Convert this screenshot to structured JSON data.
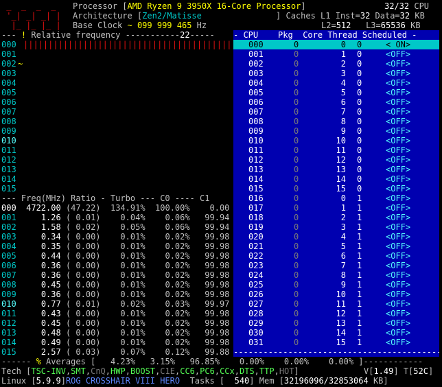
{
  "header": {
    "processor_label": "Processor [",
    "processor_name": "AMD Ryzen 9 3950X 16-Core Processor",
    "processor_close": "]",
    "cpu_count": "32/32",
    "cpu_label": "CPU",
    "arch_label": "Architecture [",
    "arch_value": "Zen2/Matisse",
    "arch_close": "]",
    "caches_label": "Caches L1 Inst=",
    "l1_inst": "32",
    "l1_data_label": "Data=",
    "l1_data": "32",
    "kb1": "KB",
    "base_clock_label": "Base Clock",
    "base_clock_tilde": "~",
    "base_clock_value": "099 999 465",
    "hz": "Hz",
    "l2_label": "L2=",
    "l2_value": "512",
    "l3_label": "L3=",
    "l3_value": "65536",
    "kb2": "KB"
  },
  "freq_header": {
    "prefix": "--- ",
    "excl": "!",
    "label": " Relative frequency -----------",
    "value": "22",
    "suffix": "-----"
  },
  "rows_top": [
    "000",
    "001",
    "002",
    "003",
    "004",
    "005",
    "006",
    "007",
    "008",
    "009",
    "010",
    "011",
    "012",
    "013",
    "014",
    "015"
  ],
  "row002_marker": "~",
  "stats_header": "--- Freq(MHz) Ratio - Turbo --- C0 ---- C1",
  "stats": [
    {
      "id": "000",
      "freq": "4722.00",
      "ratio": "(47.22)",
      "turbo": "134.91%",
      "c0": "100.00%",
      "c1": "0.00"
    },
    {
      "id": "001",
      "freq": "1.26",
      "ratio": "( 0.01)",
      "turbo": "0.04%",
      "c0": "0.06%",
      "c1": "99.94"
    },
    {
      "id": "002",
      "freq": "1.58",
      "ratio": "( 0.02)",
      "turbo": "0.05%",
      "c0": "0.06%",
      "c1": "99.94"
    },
    {
      "id": "003",
      "freq": "0.34",
      "ratio": "( 0.00)",
      "turbo": "0.01%",
      "c0": "0.02%",
      "c1": "99.98"
    },
    {
      "id": "004",
      "freq": "0.35",
      "ratio": "( 0.00)",
      "turbo": "0.01%",
      "c0": "0.02%",
      "c1": "99.98"
    },
    {
      "id": "005",
      "freq": "0.44",
      "ratio": "( 0.00)",
      "turbo": "0.01%",
      "c0": "0.02%",
      "c1": "99.98"
    },
    {
      "id": "006",
      "freq": "0.36",
      "ratio": "( 0.00)",
      "turbo": "0.01%",
      "c0": "0.02%",
      "c1": "99.98"
    },
    {
      "id": "007",
      "freq": "0.36",
      "ratio": "( 0.00)",
      "turbo": "0.01%",
      "c0": "0.02%",
      "c1": "99.98"
    },
    {
      "id": "008",
      "freq": "0.45",
      "ratio": "( 0.00)",
      "turbo": "0.01%",
      "c0": "0.02%",
      "c1": "99.98"
    },
    {
      "id": "009",
      "freq": "0.36",
      "ratio": "( 0.00)",
      "turbo": "0.01%",
      "c0": "0.02%",
      "c1": "99.98"
    },
    {
      "id": "010",
      "freq": "0.77",
      "ratio": "( 0.01)",
      "turbo": "0.02%",
      "c0": "0.03%",
      "c1": "99.97"
    },
    {
      "id": "011",
      "freq": "0.43",
      "ratio": "( 0.00)",
      "turbo": "0.01%",
      "c0": "0.02%",
      "c1": "99.98"
    },
    {
      "id": "012",
      "freq": "0.45",
      "ratio": "( 0.00)",
      "turbo": "0.01%",
      "c0": "0.02%",
      "c1": "99.98"
    },
    {
      "id": "013",
      "freq": "0.48",
      "ratio": "( 0.00)",
      "turbo": "0.01%",
      "c0": "0.02%",
      "c1": "99.98"
    },
    {
      "id": "014",
      "freq": "0.49",
      "ratio": "( 0.00)",
      "turbo": "0.01%",
      "c0": "0.02%",
      "c1": "99.98"
    },
    {
      "id": "015",
      "freq": "2.57",
      "ratio": "( 0.03)",
      "turbo": "0.07%",
      "c0": "0.12%",
      "c1": "99.88"
    }
  ],
  "averages": {
    "prefix": "------ ",
    "pct": "%",
    "label": " Averages [",
    "v1": "4.23%",
    "v2": "3.15%",
    "v3": "96.85%",
    "v4": "0.00%",
    "v5": "0.00%",
    "v6": "0.00%",
    "close": "]",
    "suffix": "------------"
  },
  "tech": {
    "label": "Tech [",
    "items": [
      "TSC-INV",
      "SMT",
      "CnQ",
      "HWP",
      "BOOST",
      "C1E",
      "CC6",
      "PC6",
      "CCx",
      "DTS",
      "TTP",
      "HOT"
    ],
    "close": "]",
    "v_label": "V[",
    "v_value": "1.49",
    "v_close": "]",
    "t_label": "T[",
    "t_value": "52C",
    "t_close": "]"
  },
  "status": {
    "linux_label": "Linux [",
    "kernel": "5.9.9",
    "kernel_close": "]",
    "host": "ROG CROSSHAIR VIII HERO",
    "tasks_label": "Tasks [",
    "tasks_value": "540",
    "tasks_close": "]",
    "mem_label": "Mem [",
    "mem_value": "32196096/32853064",
    "mem_unit": "KB",
    "mem_close": "]"
  },
  "panel": {
    "headers": {
      "cpu": "CPU",
      "pkg": "Pkg",
      "core": "Core",
      "thread": "Thread",
      "scheduled": "Scheduled"
    },
    "rows": [
      {
        "cpu": "000",
        "pkg": "0",
        "core": "0",
        "thread": "0",
        "sched": "< ON>"
      },
      {
        "cpu": "001",
        "pkg": "0",
        "core": "1",
        "thread": "0",
        "sched": "<OFF>"
      },
      {
        "cpu": "002",
        "pkg": "0",
        "core": "2",
        "thread": "0",
        "sched": "<OFF>"
      },
      {
        "cpu": "003",
        "pkg": "0",
        "core": "3",
        "thread": "0",
        "sched": "<OFF>"
      },
      {
        "cpu": "004",
        "pkg": "0",
        "core": "4",
        "thread": "0",
        "sched": "<OFF>"
      },
      {
        "cpu": "005",
        "pkg": "0",
        "core": "5",
        "thread": "0",
        "sched": "<OFF>"
      },
      {
        "cpu": "006",
        "pkg": "0",
        "core": "6",
        "thread": "0",
        "sched": "<OFF>"
      },
      {
        "cpu": "007",
        "pkg": "0",
        "core": "7",
        "thread": "0",
        "sched": "<OFF>"
      },
      {
        "cpu": "008",
        "pkg": "0",
        "core": "8",
        "thread": "0",
        "sched": "<OFF>"
      },
      {
        "cpu": "009",
        "pkg": "0",
        "core": "9",
        "thread": "0",
        "sched": "<OFF>"
      },
      {
        "cpu": "010",
        "pkg": "0",
        "core": "10",
        "thread": "0",
        "sched": "<OFF>"
      },
      {
        "cpu": "011",
        "pkg": "0",
        "core": "11",
        "thread": "0",
        "sched": "<OFF>"
      },
      {
        "cpu": "012",
        "pkg": "0",
        "core": "12",
        "thread": "0",
        "sched": "<OFF>"
      },
      {
        "cpu": "013",
        "pkg": "0",
        "core": "13",
        "thread": "0",
        "sched": "<OFF>"
      },
      {
        "cpu": "014",
        "pkg": "0",
        "core": "14",
        "thread": "0",
        "sched": "<OFF>"
      },
      {
        "cpu": "015",
        "pkg": "0",
        "core": "15",
        "thread": "0",
        "sched": "<OFF>"
      },
      {
        "cpu": "016",
        "pkg": "0",
        "core": "0",
        "thread": "1",
        "sched": "<OFF>"
      },
      {
        "cpu": "017",
        "pkg": "0",
        "core": "1",
        "thread": "1",
        "sched": "<OFF>"
      },
      {
        "cpu": "018",
        "pkg": "0",
        "core": "2",
        "thread": "1",
        "sched": "<OFF>"
      },
      {
        "cpu": "019",
        "pkg": "0",
        "core": "3",
        "thread": "1",
        "sched": "<OFF>"
      },
      {
        "cpu": "020",
        "pkg": "0",
        "core": "4",
        "thread": "1",
        "sched": "<OFF>"
      },
      {
        "cpu": "021",
        "pkg": "0",
        "core": "5",
        "thread": "1",
        "sched": "<OFF>"
      },
      {
        "cpu": "022",
        "pkg": "0",
        "core": "6",
        "thread": "1",
        "sched": "<OFF>"
      },
      {
        "cpu": "023",
        "pkg": "0",
        "core": "7",
        "thread": "1",
        "sched": "<OFF>"
      },
      {
        "cpu": "024",
        "pkg": "0",
        "core": "8",
        "thread": "1",
        "sched": "<OFF>"
      },
      {
        "cpu": "025",
        "pkg": "0",
        "core": "9",
        "thread": "1",
        "sched": "<OFF>"
      },
      {
        "cpu": "026",
        "pkg": "0",
        "core": "10",
        "thread": "1",
        "sched": "<OFF>"
      },
      {
        "cpu": "027",
        "pkg": "0",
        "core": "11",
        "thread": "1",
        "sched": "<OFF>"
      },
      {
        "cpu": "028",
        "pkg": "0",
        "core": "12",
        "thread": "1",
        "sched": "<OFF>"
      },
      {
        "cpu": "029",
        "pkg": "0",
        "core": "13",
        "thread": "1",
        "sched": "<OFF>"
      },
      {
        "cpu": "030",
        "pkg": "0",
        "core": "14",
        "thread": "1",
        "sched": "<OFF>"
      },
      {
        "cpu": "031",
        "pkg": "0",
        "core": "15",
        "thread": "1",
        "sched": "<OFF>"
      }
    ]
  },
  "colors": {
    "panel_bg": "#0000b0",
    "selected_bg": "#00c8c8",
    "accent": "#ffff00",
    "logo": "#e01010"
  }
}
